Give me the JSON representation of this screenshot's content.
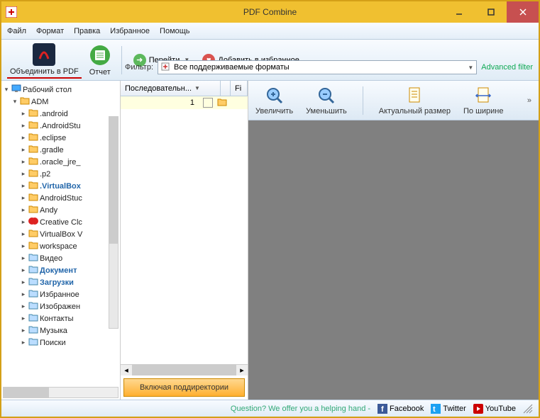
{
  "title": "PDF Combine",
  "menu": {
    "file": "Файл",
    "format": "Формат",
    "edit": "Правка",
    "favorites": "Избранное",
    "help": "Помощь"
  },
  "toolbar": {
    "combine": "Объединить в PDF",
    "report": "Отчет",
    "go": "Перейти",
    "addfav": "Добавить в избранное"
  },
  "filter": {
    "label": "Фильтр:",
    "value": "Все поддерживаемые форматы",
    "advanced": "Advanced filter"
  },
  "tree": {
    "root": "Рабочий стол",
    "adm": "ADM",
    "items": [
      ".android",
      ".AndroidStu",
      ".eclipse",
      ".gradle",
      ".oracle_jre_",
      ".p2",
      ".VirtualBox",
      "AndroidStuc",
      "Andy",
      "Creative Clc",
      "VirtualBox V",
      "workspace",
      "Видео",
      "Документ",
      "Загрузки",
      "Избранное",
      "Изображен",
      "Контакты",
      "Музыка",
      "Поиски"
    ]
  },
  "middle": {
    "col1": "Последовательн...",
    "col2": "Fi",
    "row1_num": "1",
    "subdirs": "Включая поддиректории"
  },
  "preview": {
    "zoomin": "Увеличить",
    "zoomout": "Уменьшить",
    "actual": "Актуальный размер",
    "fitwidth": "По ширине"
  },
  "status": {
    "question": "Question? We offer you a helping hand -",
    "fb": "Facebook",
    "tw": "Twitter",
    "yt": "YouTube"
  }
}
